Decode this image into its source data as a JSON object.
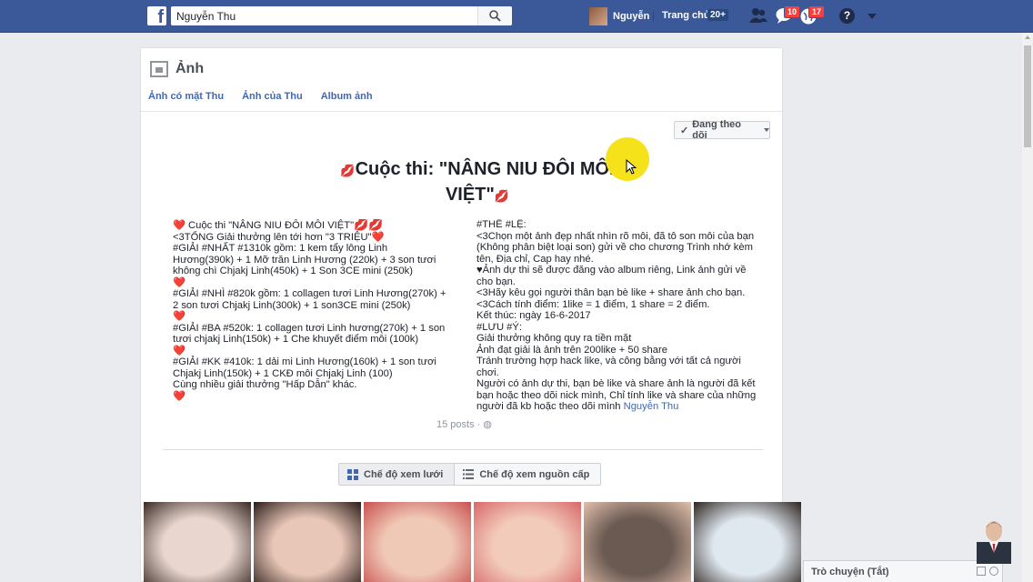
{
  "topbar": {
    "search_value": "Nguyễn Thu",
    "user_name": "Nguyễn",
    "home_label": "Trang chủ",
    "home_count": "20+",
    "messages_badge": "10",
    "notifications_badge": "17"
  },
  "section": {
    "title": "Ảnh",
    "tabs": [
      {
        "label": "Ảnh có mặt Thu"
      },
      {
        "label": "Ảnh của Thu"
      },
      {
        "label": "Album ảnh"
      }
    ],
    "follow_label": "Đang theo dõi"
  },
  "post": {
    "title_line1": "Cuộc thi: \"NÂNG NIU ĐÔI MÔI",
    "title_line2": "VIỆT\"",
    "left_lines": [
      "Cuộc thi \"NÂNG NIU ĐÔI MÔI VIỆT\"",
      "<3TỔNG Giải thưởng lên tới hơn \"3 TRIỆU\"",
      "#GIẢI #NHẤT #1310k gồm: 1 kem tẩy lông Linh Hương(390k) + 1 Mỡ trăn Linh Hương (220k) + 3 son tươi không chì Chjakj Linh(450k) + 1 Son 3CE mini (250k)",
      "",
      "#GIẢI #NHÌ #820k gồm: 1 collagen tươi Linh Hương(270k) + 2 son tươi Chjakj Linh(300k) + 1 son3CE mini (250k)",
      "",
      "#GIẢI #BA #520k: 1 collagen tươi Linh hương(270k) + 1 son tươi chjakj Linh(150k) + 1 Che khuyết điểm môi (100k)",
      "",
      "#GIẢI #KK #410k: 1 dải mi Linh Hương(160k) + 1 son tươi Chjakj Linh(150k) + 1 CKĐ môi Chjakj Linh (100)",
      "Cùng nhiều giải thưởng \"Hấp Dẫn\" khác.",
      ""
    ],
    "right_lines": [
      "#THỂ #LỆ:",
      "<3Chọn một ảnh đẹp nhất nhìn rõ môi, đã tô son môi của bạn (Không phân biệt loại son) gửi về cho chương Trình nhớ kèm tên, Địa chỉ, Cap hay nhé.",
      "♥Ảnh dự thi sẽ được đăng vào album riêng, Link ảnh gửi về cho bạn.",
      "<3Hãy kêu gọi người thân bạn bè like + share ảnh cho bạn.",
      "<3Cách tính điểm: 1like = 1 điểm, 1 share = 2 điểm.",
      "Kết thúc: ngày 16-6-2017",
      "#LƯU #Ý:",
      "Giải thưởng không quy ra tiền mặt",
      "Ảnh đạt giải là ảnh trên 200like + 50 share",
      "Tránh trường hợp hack like, và công bằng với tất cả người chơi.",
      "Người có ảnh dự thi, bạn bè like và share ảnh là người đã kết bạn hoặc theo dõi nick mình, Chỉ tính like và share của những người đã kb hoặc theo dõi mình"
    ],
    "right_link": "Nguyễn Thu",
    "posts_count": "15 posts"
  },
  "view_toggle": {
    "grid_label": "Chế độ xem lưới",
    "feed_label": "Chế độ xem nguồn cấp"
  },
  "photos": [
    {
      "colors": [
        "#e8d6cf",
        "#3a2a24"
      ]
    },
    {
      "colors": [
        "#e9c7b8",
        "#2a1c18"
      ]
    },
    {
      "colors": [
        "#f0c9b6",
        "#c85050"
      ]
    },
    {
      "colors": [
        "#f2cbbb",
        "#d86868"
      ]
    },
    {
      "colors": [
        "#6a5a52",
        "#e3c0ad"
      ]
    },
    {
      "colors": [
        "#dfe8ef",
        "#2d2420"
      ]
    }
  ],
  "chat": {
    "label": "Trò chuyện (Tắt)"
  },
  "colors": {
    "brand_blue": "#3b5998",
    "link_blue": "#4267b2",
    "badge_red": "#fa3e3e",
    "highlight_yellow": "#f5e21b"
  }
}
